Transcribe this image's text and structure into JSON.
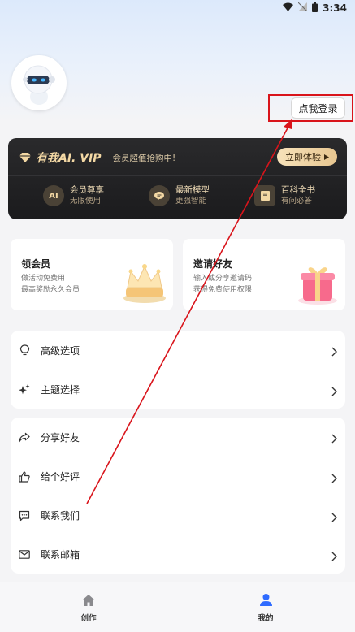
{
  "status_bar": {
    "time": "3:34"
  },
  "profile": {
    "login_label": "点我登录"
  },
  "vip": {
    "title": "有我AI. VIP",
    "subtitle": "会员超值抢购中!",
    "cta_label": "立即体验",
    "features": [
      {
        "title": "会员尊享",
        "sub": "无限使用",
        "icon": "ai-icon"
      },
      {
        "title": "最新模型",
        "sub": "更强智能",
        "icon": "chat-bubble-icon"
      },
      {
        "title": "百科全书",
        "sub": "有问必答",
        "icon": "book-icon"
      }
    ]
  },
  "promos": [
    {
      "title": "领会员",
      "desc_line1": "做活动免费用",
      "desc_line2": "最高奖励永久会员"
    },
    {
      "title": "邀请好友",
      "desc_line1": "输入或分享邀请码",
      "desc_line2": "获得免费使用权限"
    }
  ],
  "menu_group1": [
    {
      "label": "高级选项",
      "icon": "lightbulb-icon"
    },
    {
      "label": "主题选择",
      "icon": "sparkle-icon"
    }
  ],
  "menu_group2": [
    {
      "label": "分享好友",
      "icon": "share-icon"
    },
    {
      "label": "给个好评",
      "icon": "thumbs-up-icon"
    },
    {
      "label": "联系我们",
      "icon": "message-icon"
    },
    {
      "label": "联系邮箱",
      "icon": "mail-icon"
    }
  ],
  "bottom_nav": [
    {
      "label": "创作",
      "icon": "home-icon",
      "active": false
    },
    {
      "label": "我的",
      "icon": "person-icon",
      "active": true
    }
  ],
  "colors": {
    "accent": "#2f6bff",
    "annotation": "#d9141b",
    "vip_gold": "#f3d8a4"
  }
}
